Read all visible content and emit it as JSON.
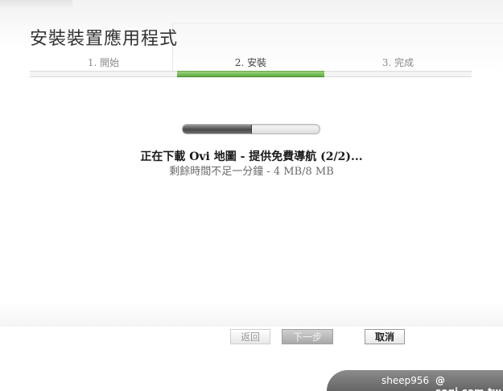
{
  "window": {
    "title": "安裝裝置應用程式"
  },
  "steps": [
    {
      "label": "1. 開始",
      "active": false
    },
    {
      "label": "2. 安裝",
      "active": true
    },
    {
      "label": "3. 完成",
      "active": false
    }
  ],
  "progress": {
    "fraction": 0.5
  },
  "status": {
    "main": "正在下載 Ovi 地圖 - 提供免費導航 (2/2)...",
    "detail": "剩餘時間不足一分鐘 - 4 MB/8 MB"
  },
  "buttons": {
    "back_label": "返回",
    "next_label": "下一步",
    "cancel_label": "取消"
  },
  "watermark": {
    "user": "sheep956",
    "site": "@ sogi.com.tw"
  },
  "colors": {
    "active_step": "#5cae3b",
    "progress_fill": "#4a4a4a"
  }
}
